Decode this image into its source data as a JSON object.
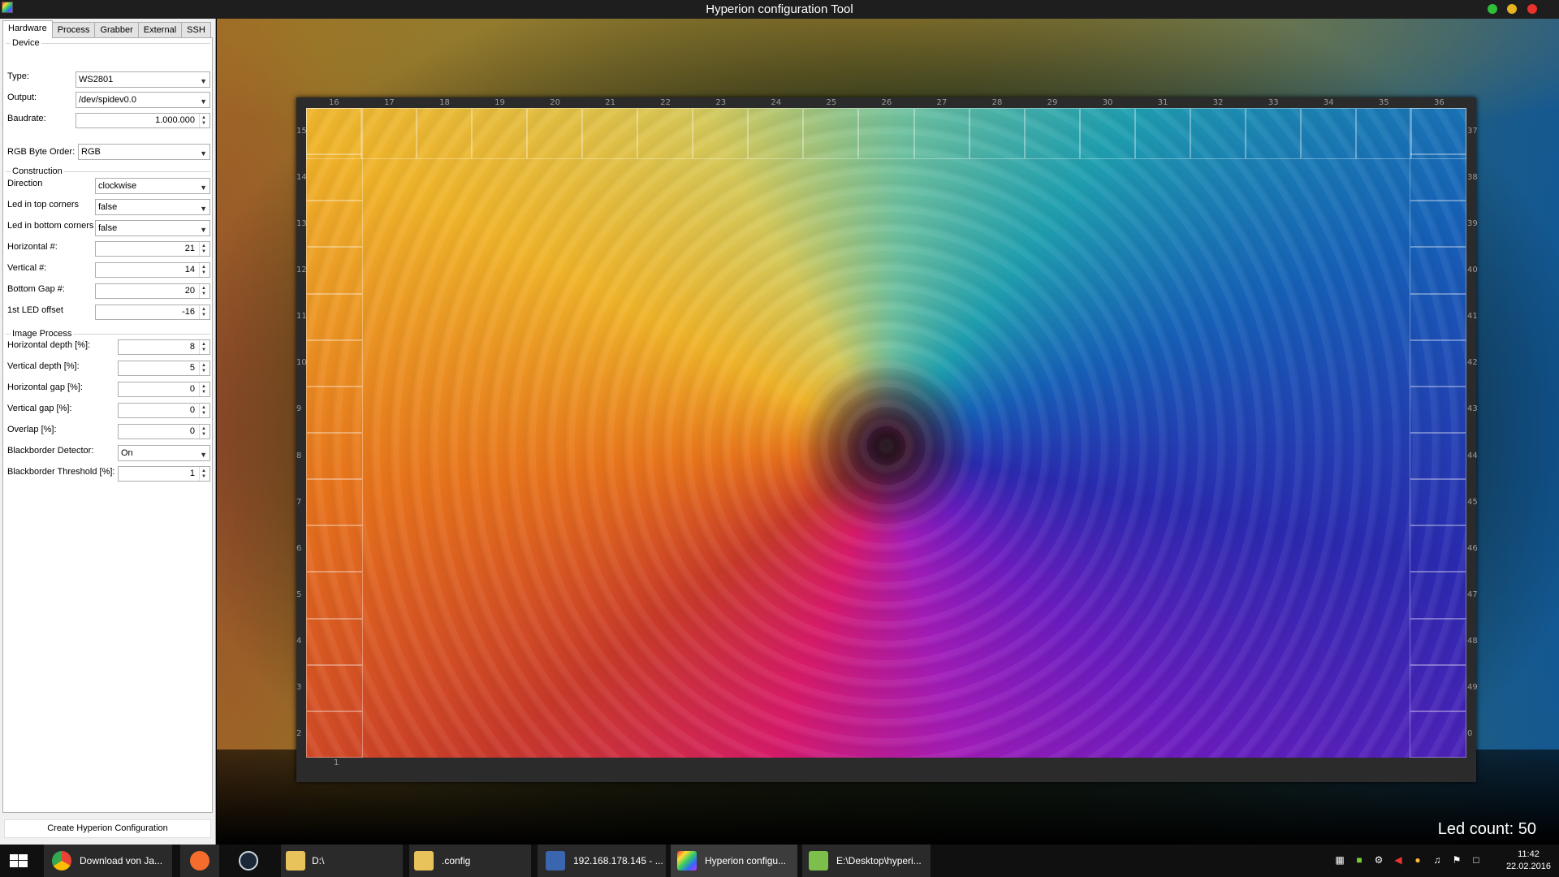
{
  "window": {
    "title": "Hyperion configuration Tool"
  },
  "tabs": [
    "Hardware",
    "Process",
    "Grabber",
    "External",
    "SSH"
  ],
  "device": {
    "group_title": "Device",
    "type_label": "Type:",
    "type_value": "WS2801",
    "output_label": "Output:",
    "output_value": "/dev/spidev0.0",
    "baud_label": "Baudrate:",
    "baud_value": "1.000.000",
    "rgb_label": "RGB Byte Order:",
    "rgb_value": "RGB"
  },
  "construction": {
    "group_title": "Construction",
    "direction_label": "Direction",
    "direction_value": "clockwise",
    "top_corners_label": "Led in top corners",
    "top_corners_value": "false",
    "bottom_corners_label": "Led in bottom corners",
    "bottom_corners_value": "false",
    "horizontal_label": "Horizontal #:",
    "horizontal_value": "21",
    "vertical_label": "Vertical #:",
    "vertical_value": "14",
    "bottom_gap_label": "Bottom Gap #:",
    "bottom_gap_value": "20",
    "offset_label": "1st LED offset",
    "offset_value": "-16"
  },
  "image_process": {
    "group_title": "Image Process",
    "hdepth_label": "Horizontal depth [%]:",
    "hdepth_value": "8",
    "vdepth_label": "Vertical depth [%]:",
    "vdepth_value": "5",
    "hgap_label": "Horizontal gap [%]:",
    "hgap_value": "0",
    "vgap_label": "Vertical gap [%]:",
    "vgap_value": "0",
    "overlap_label": "Overlap [%]:",
    "overlap_value": "0",
    "bb_detector_label": "Blackborder Detector:",
    "bb_detector_value": "On",
    "bb_threshold_label": "Blackborder Threshold [%]:",
    "bb_threshold_value": "1"
  },
  "create_button": "Create Hyperion Configuration",
  "led_count": "Led count: 50",
  "led_numbers": {
    "top": [
      "16",
      "17",
      "18",
      "19",
      "20",
      "21",
      "22",
      "23",
      "24",
      "25",
      "26",
      "27",
      "28",
      "29",
      "30",
      "31",
      "32",
      "33",
      "34",
      "35",
      "36"
    ],
    "left": [
      "15",
      "14",
      "13",
      "12",
      "11",
      "10",
      "9",
      "8",
      "7",
      "6",
      "5",
      "4",
      "3",
      "2"
    ],
    "right": [
      "37",
      "38",
      "39",
      "40",
      "41",
      "42",
      "43",
      "44",
      "45",
      "46",
      "47",
      "48",
      "49",
      "0"
    ],
    "bottom": "1"
  },
  "taskbar": {
    "items": [
      {
        "label": "Download von Ja...",
        "icon": "chrome-icon"
      },
      {
        "label": "",
        "icon": "origin-icon"
      },
      {
        "label": "",
        "icon": "steam-icon"
      },
      {
        "label": "D:\\",
        "icon": "folder-icon"
      },
      {
        "label": ".config",
        "icon": "folder-icon"
      },
      {
        "label": "192.168.178.145 - ...",
        "icon": "network-icon"
      },
      {
        "label": "Hyperion configu...",
        "icon": "hyperion-icon"
      },
      {
        "label": "E:\\Desktop\\hyperi...",
        "icon": "notepad-icon"
      }
    ],
    "time": "11:42",
    "date": "22.02.2016"
  }
}
